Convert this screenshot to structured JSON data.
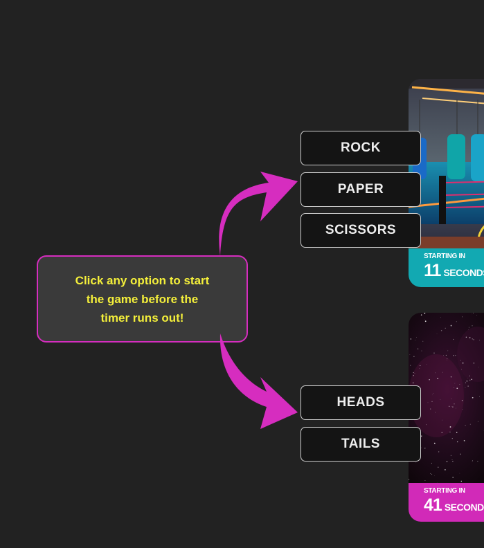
{
  "tip": {
    "text": "Click any option to start\nthe game before the\ntimer runs out!"
  },
  "games": [
    {
      "options": [
        "ROCK",
        "PAPER",
        "SCISSORS"
      ],
      "timer": {
        "label": "STARTING IN",
        "value": "11",
        "unit": "SECONDS"
      },
      "timer_color": "#12a9b2"
    },
    {
      "options": [
        "HEADS",
        "TAILS"
      ],
      "timer": {
        "label": "STARTING IN",
        "value": "41",
        "unit": "SECONDS"
      },
      "timer_color": "#d12ab8"
    }
  ],
  "colors": {
    "accent": "#d62dbf",
    "tip_text": "#f4ef3a",
    "background": "#222222"
  }
}
